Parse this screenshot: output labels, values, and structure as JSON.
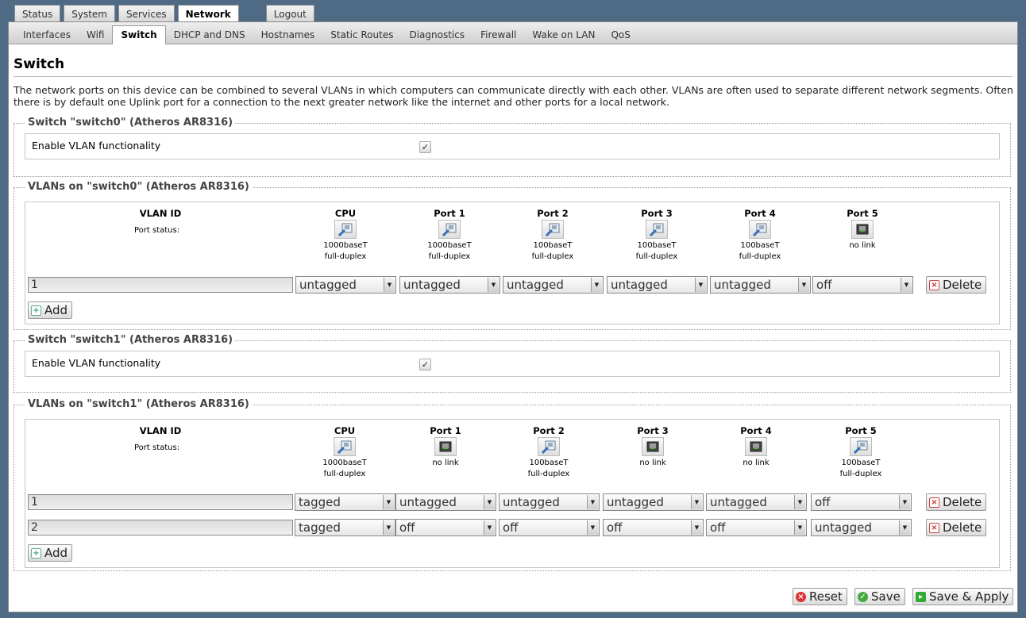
{
  "main_tabs": [
    {
      "label": "Status"
    },
    {
      "label": "System"
    },
    {
      "label": "Services"
    },
    {
      "label": "Network"
    },
    {
      "label": "Logout"
    }
  ],
  "sub_tabs": [
    {
      "label": "Interfaces"
    },
    {
      "label": "Wifi"
    },
    {
      "label": "Switch"
    },
    {
      "label": "DHCP and DNS"
    },
    {
      "label": "Hostnames"
    },
    {
      "label": "Static Routes"
    },
    {
      "label": "Diagnostics"
    },
    {
      "label": "Firewall"
    },
    {
      "label": "Wake on LAN"
    },
    {
      "label": "QoS"
    }
  ],
  "page": {
    "title": "Switch",
    "description": "The network ports on this device can be combined to several VLANs in which computers can communicate directly with each other. VLANs are often used to separate different network segments. Often there is by default one Uplink port for a connection to the next greater network like the internet and other ports for a local network."
  },
  "switch0": {
    "legend": "Switch \"switch0\" (Atheros AR8316)",
    "enable_label": "Enable VLAN functionality",
    "enable_checked": "✓"
  },
  "vlans0": {
    "legend": "VLANs on \"switch0\" (Atheros AR8316)",
    "vlan_id_header": "VLAN ID",
    "port_status_label": "Port status:",
    "columns": [
      {
        "name": "CPU",
        "status1": "1000baseT",
        "status2": "full-duplex",
        "link": "up"
      },
      {
        "name": "Port 1",
        "status1": "1000baseT",
        "status2": "full-duplex",
        "link": "up"
      },
      {
        "name": "Port 2",
        "status1": "100baseT",
        "status2": "full-duplex",
        "link": "up"
      },
      {
        "name": "Port 3",
        "status1": "100baseT",
        "status2": "full-duplex",
        "link": "up"
      },
      {
        "name": "Port 4",
        "status1": "100baseT",
        "status2": "full-duplex",
        "link": "up"
      },
      {
        "name": "Port 5",
        "status1": "no link",
        "status2": "",
        "link": "down"
      }
    ],
    "rows": [
      {
        "id": "1",
        "values": [
          "untagged",
          "untagged",
          "untagged",
          "untagged",
          "untagged",
          "off"
        ]
      }
    ],
    "delete_label": "Delete",
    "add_label": "Add"
  },
  "switch1": {
    "legend": "Switch \"switch1\" (Atheros AR8316)",
    "enable_label": "Enable VLAN functionality",
    "enable_checked": "✓"
  },
  "vlans1": {
    "legend": "VLANs on \"switch1\" (Atheros AR8316)",
    "vlan_id_header": "VLAN ID",
    "port_status_label": "Port status:",
    "columns": [
      {
        "name": "CPU",
        "status1": "1000baseT",
        "status2": "full-duplex",
        "link": "up"
      },
      {
        "name": "Port 1",
        "status1": "no link",
        "status2": "",
        "link": "down"
      },
      {
        "name": "Port 2",
        "status1": "100baseT",
        "status2": "full-duplex",
        "link": "up"
      },
      {
        "name": "Port 3",
        "status1": "no link",
        "status2": "",
        "link": "down"
      },
      {
        "name": "Port 4",
        "status1": "no link",
        "status2": "",
        "link": "down"
      },
      {
        "name": "Port 5",
        "status1": "100baseT",
        "status2": "full-duplex",
        "link": "up"
      }
    ],
    "rows": [
      {
        "id": "1",
        "values": [
          "tagged",
          "untagged",
          "untagged",
          "untagged",
          "untagged",
          "off"
        ]
      },
      {
        "id": "2",
        "values": [
          "tagged",
          "off",
          "off",
          "off",
          "off",
          "untagged"
        ]
      }
    ],
    "delete_label": "Delete",
    "add_label": "Add"
  },
  "footer": {
    "reset_label": "Reset",
    "save_label": "Save",
    "apply_label": "Save & Apply"
  }
}
